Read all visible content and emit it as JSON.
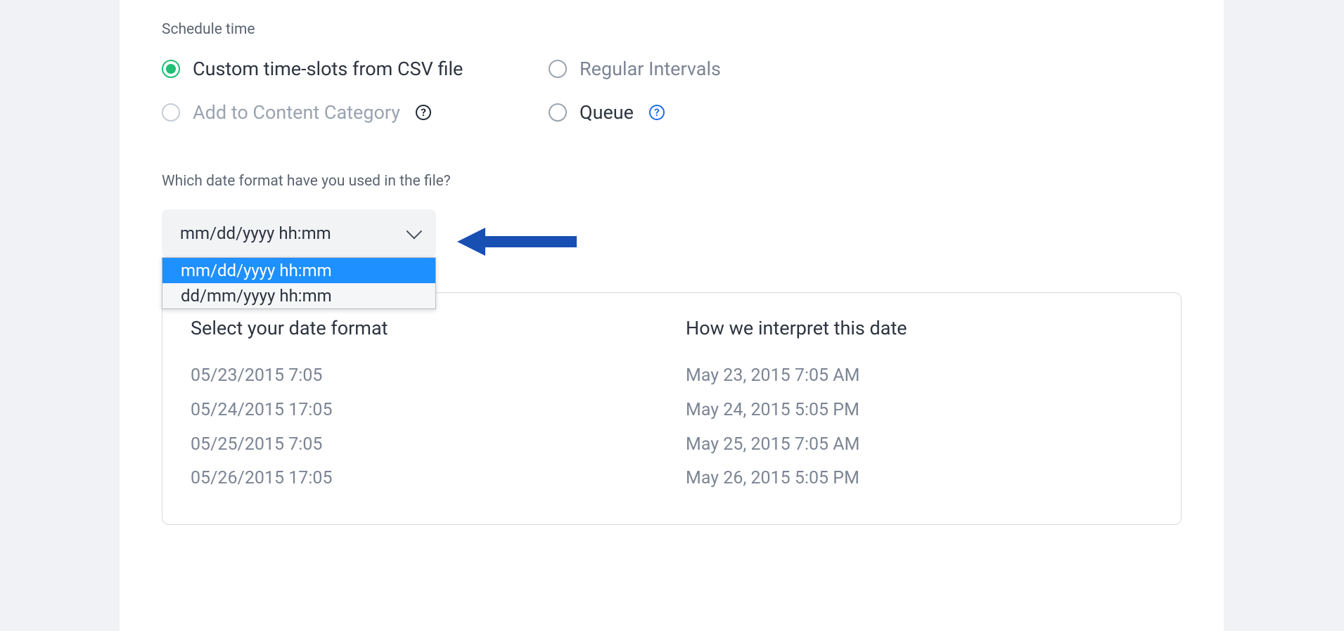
{
  "section_label": "Schedule time",
  "radios": {
    "custom_csv": "Custom time-slots from CSV file",
    "regular_intervals": "Regular Intervals",
    "content_category": "Add to Content Category",
    "queue": "Queue"
  },
  "question_label": "Which date format have you used in the file?",
  "dropdown": {
    "selected": "mm/dd/yyyy hh:mm",
    "options": [
      "mm/dd/yyyy hh:mm",
      "dd/mm/yyyy hh:mm"
    ]
  },
  "preview": {
    "col1_header": "Select your date format",
    "col2_header": "How we interpret this date",
    "rows": [
      {
        "input": "05/23/2015 7:05",
        "interpreted": "May 23, 2015 7:05 AM"
      },
      {
        "input": "05/24/2015 17:05",
        "interpreted": "May 24, 2015 5:05 PM"
      },
      {
        "input": "05/25/2015 7:05",
        "interpreted": "May 25, 2015 7:05 AM"
      },
      {
        "input": "05/26/2015 17:05",
        "interpreted": "May 26, 2015 5:05 PM"
      }
    ]
  }
}
